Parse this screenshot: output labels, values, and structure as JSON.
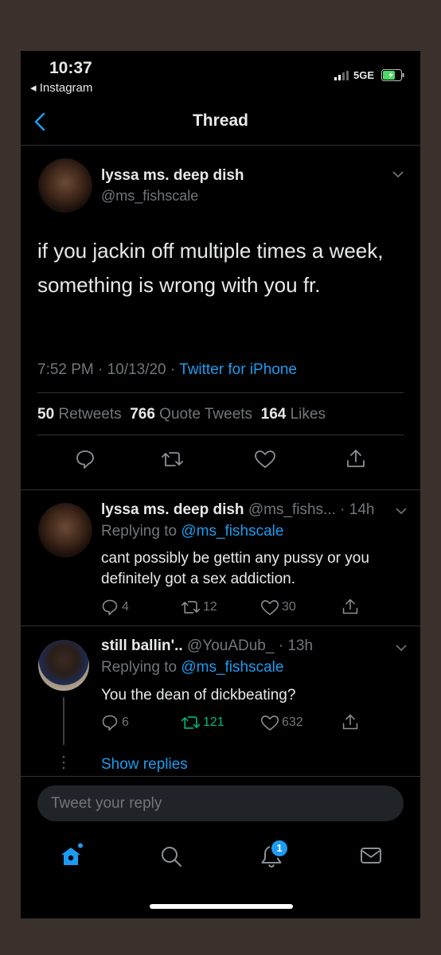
{
  "status_bar": {
    "time": "10:37",
    "back_app": "◂ Instagram",
    "network": "5GE"
  },
  "header": {
    "title": "Thread"
  },
  "main_tweet": {
    "name": "lyssa ms. deep dish",
    "handle": "@ms_fishscale",
    "text": "if you jackin off multiple times a week, something is wrong with you fr.",
    "meta_time": "7:52 PM · 10/13/20 · ",
    "meta_source": "Twitter for iPhone",
    "retweets_count": "50",
    "retweets_label": "Retweets",
    "quotes_count": "766",
    "quotes_label": "Quote Tweets",
    "likes_count": "164",
    "likes_label": "Likes"
  },
  "replies": [
    {
      "name": "lyssa ms. deep dish",
      "handle_time": "@ms_fishs... · 14h",
      "replying_prefix": "Replying to ",
      "replying_to": "@ms_fishscale",
      "text": "cant possibly be gettin any pussy or you definitely got a sex addiction.",
      "reply_count": "4",
      "retweet_count": "12",
      "like_count": "30"
    },
    {
      "name": "still ballin'..",
      "handle_time": "@YouADub_ · 13h",
      "replying_prefix": "Replying to ",
      "replying_to": "@ms_fishscale",
      "text": "You the dean of dickbeating?",
      "reply_count": "6",
      "retweet_count": "121",
      "like_count": "632"
    }
  ],
  "show_replies": "Show replies",
  "composer": {
    "placeholder": "Tweet your reply"
  },
  "tab_bar": {
    "notifications_badge": "1"
  },
  "colors": {
    "accent": "#1d9bf0",
    "retweeted": "#00ba7c",
    "background": "#000000"
  }
}
